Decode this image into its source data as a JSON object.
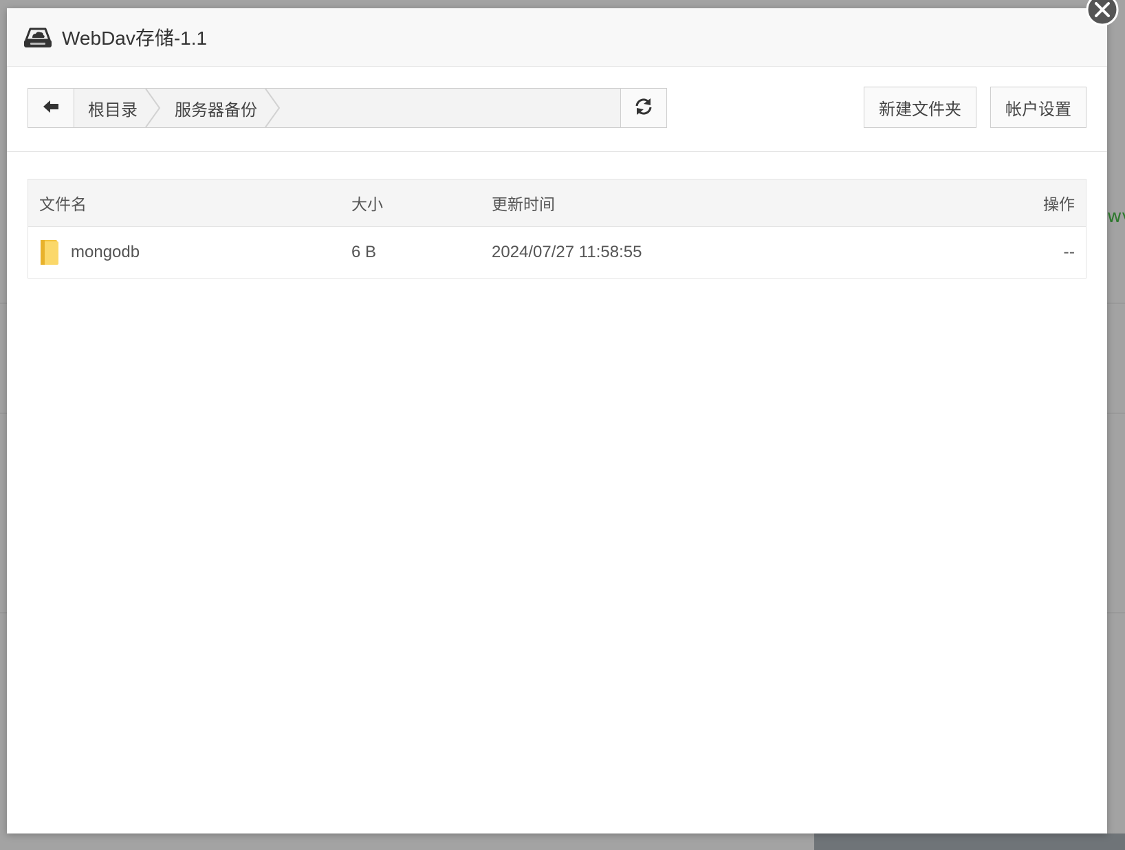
{
  "window": {
    "title": "WebDav存储-1.1",
    "logo_icon": "cloud-drive-icon",
    "close_icon": "close-icon"
  },
  "toolbar": {
    "back_icon": "arrow-left-icon",
    "breadcrumb": [
      {
        "label": "根目录"
      },
      {
        "label": "服务器备份"
      }
    ],
    "refresh_icon": "refresh-icon",
    "new_folder_label": "新建文件夹",
    "account_settings_label": "帐户设置"
  },
  "table": {
    "columns": [
      "文件名",
      "大小",
      "更新时间",
      "操作"
    ],
    "rows": [
      {
        "icon": "folder-icon",
        "name": "mongodb",
        "size": "6 B",
        "updated": "2024/07/27 11:58:55",
        "action": "--"
      }
    ]
  },
  "background": {
    "partial_text": "wv"
  },
  "colors": {
    "header_bg": "#f8f8f8",
    "folder_yellow": "#f5c94a",
    "text": "#444444",
    "border": "#cfcfcf"
  }
}
